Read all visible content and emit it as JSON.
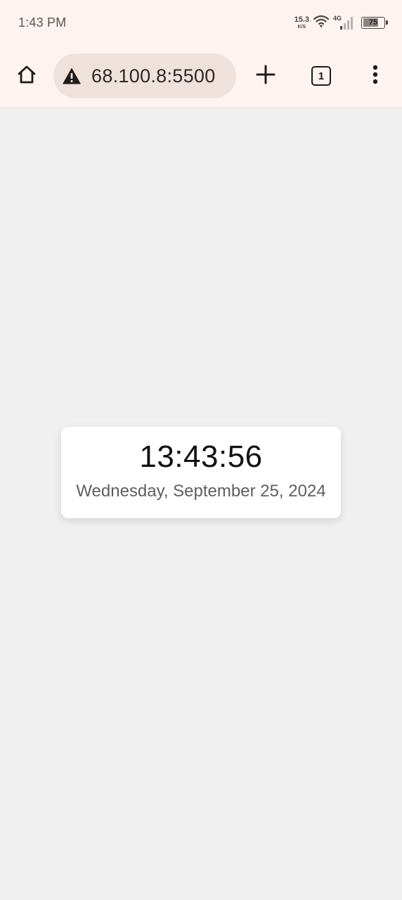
{
  "status_bar": {
    "time": "1:43 PM",
    "net_speed_value": "15.3",
    "net_speed_unit": "K/S",
    "network_type": "4G",
    "battery_level": "75",
    "battery_percent": 75
  },
  "browser": {
    "address": "68.100.8:5500",
    "tab_count": "1",
    "icons": {
      "home": "home-icon",
      "security": "not-secure-warning-icon",
      "new_tab": "plus-icon",
      "tabs": "tab-switcher-icon",
      "menu": "more-vertical-icon"
    }
  },
  "clock": {
    "time": "13:43:56",
    "date": "Wednesday, September 25, 2024"
  },
  "colors": {
    "chrome_bg": "#fdf4f1",
    "omnibox_bg": "#efe2dd",
    "page_bg": "#f0f0f0",
    "card_bg": "#ffffff"
  }
}
